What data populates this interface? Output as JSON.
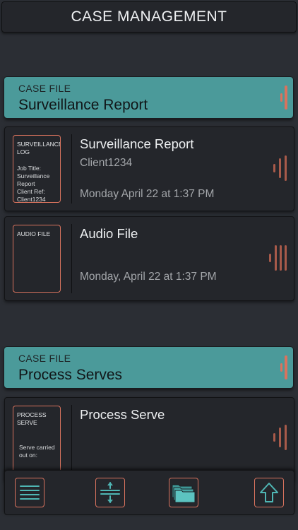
{
  "header": {
    "title": "CASE MANAGEMENT"
  },
  "cases": [
    {
      "label": "CASE FILE",
      "name": "Surveillance Report",
      "files": [
        {
          "thumb_title": "SURVEILLANCE LOG",
          "thumb_body": "Job Title:\nSurveillance Report\nClient Ref:\nClient1234",
          "title": "Surveillance Report",
          "subtitle": "Client1234",
          "date": "Monday April 22 at 1:37 PM"
        },
        {
          "thumb_title": "AUDIO FILE",
          "thumb_body": "",
          "title": "Audio File",
          "subtitle": "",
          "date": "Monday, April 22 at 1:37 PM"
        }
      ]
    },
    {
      "label": "CASE FILE",
      "name": "Process Serves",
      "files": [
        {
          "thumb_title": "PROCESS SERVE",
          "thumb_body": "Serve carried\nout on:",
          "title": "Process Serve",
          "subtitle": "",
          "date": ""
        }
      ]
    }
  ],
  "toolbar": {
    "buttons": [
      {
        "icon": "menu-icon"
      },
      {
        "icon": "expand-collapse-icon"
      },
      {
        "icon": "folders-icon"
      },
      {
        "icon": "upload-arrow-icon"
      }
    ]
  },
  "colors": {
    "accent": "#4b9a9a",
    "outline": "#d9735e",
    "background": "#2b2e34",
    "card": "#24262b"
  }
}
